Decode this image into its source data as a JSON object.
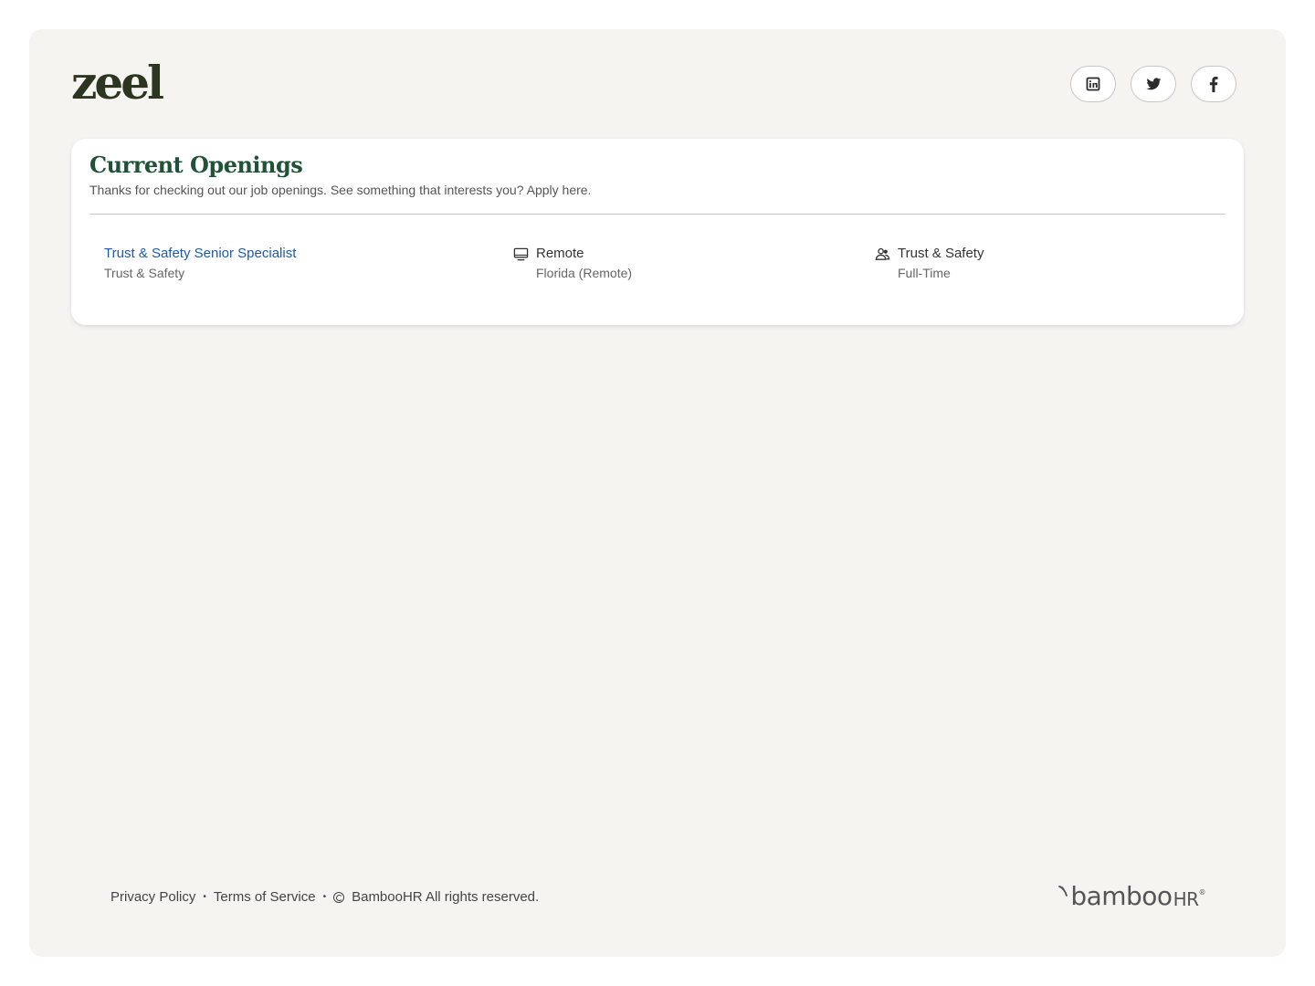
{
  "brand": {
    "logo_text": "zeel",
    "logo_color": "#2b3520"
  },
  "social": [
    {
      "name": "linkedin",
      "icon": "linkedin-icon"
    },
    {
      "name": "twitter",
      "icon": "twitter-icon"
    },
    {
      "name": "facebook",
      "icon": "facebook-icon"
    }
  ],
  "openings": {
    "title": "Current Openings",
    "subtitle": "Thanks for checking out our job openings. See something that interests you? Apply here.",
    "title_color": "#1f5236",
    "jobs": [
      {
        "title": "Trust & Safety Senior Specialist",
        "department": "Trust & Safety",
        "location_type": "Remote",
        "location": "Florida (Remote)",
        "team": "Trust & Safety",
        "employment_type": "Full-Time",
        "link_color": "#1f5aa6"
      }
    ]
  },
  "footer": {
    "privacy": "Privacy Policy",
    "terms": "Terms of Service",
    "copyright": "BambooHR All rights reserved.",
    "separator": "•"
  },
  "powered_by": {
    "brand_main": "bamboo",
    "brand_suffix": "HR",
    "reg_mark": "®"
  },
  "colors": {
    "page_bg": "#f5f4f1",
    "card_bg": "#ffffff"
  }
}
